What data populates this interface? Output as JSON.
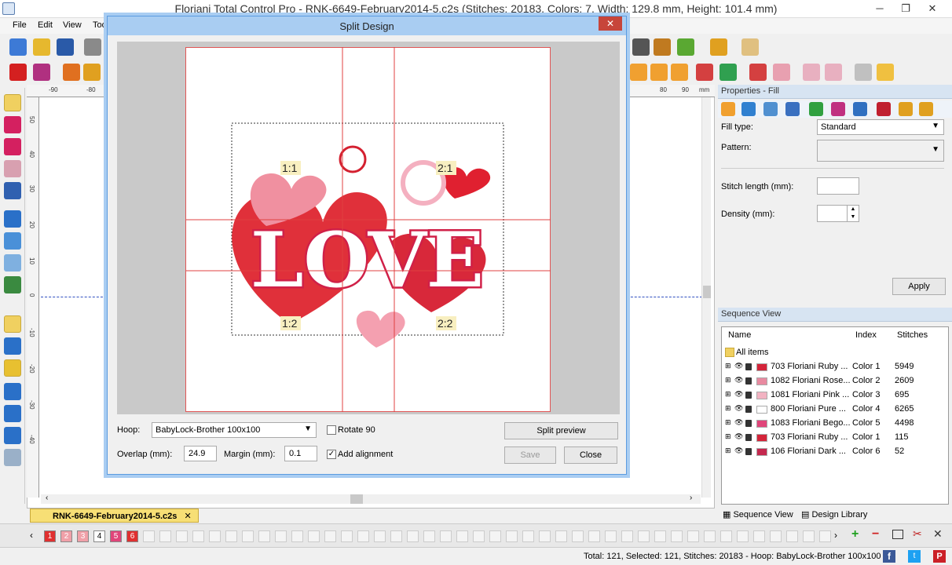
{
  "window": {
    "title": "Floriani Total Control Pro - RNK-6649-February2014-5.c2s (Stitches: 20183, Colors: 7, Width: 129.8 mm, Height: 101.4 mm)"
  },
  "menu": [
    "File",
    "Edit",
    "View",
    "Too"
  ],
  "ruler": {
    "h_labels": [
      "-90",
      "-80",
      "80",
      "90",
      "mm"
    ],
    "v_labels": [
      "50",
      "40",
      "30",
      "20",
      "10",
      "0",
      "-10",
      "-20",
      "-30",
      "-40"
    ]
  },
  "dialog": {
    "title": "Split Design",
    "close": "✕",
    "tiles": [
      "1:1",
      "2:1",
      "1:2",
      "2:2"
    ],
    "hoop_label": "Hoop:",
    "hoop_value": "BabyLock-Brother 100x100",
    "rotate_label": "Rotate 90",
    "overlap_label": "Overlap (mm):",
    "overlap_value": "24.9",
    "margin_label": "Margin (mm):",
    "margin_value": "0.1",
    "align_label": "Add alignment",
    "split_preview": "Split preview",
    "save": "Save",
    "close_btn": "Close",
    "love_text": "LOVE"
  },
  "properties": {
    "header": "Properties - Fill",
    "fill_type_label": "Fill type:",
    "fill_type_value": "Standard",
    "pattern_label": "Pattern:",
    "stitch_length_label": "Stitch length (mm):",
    "density_label": "Density (mm):",
    "apply": "Apply"
  },
  "sequence": {
    "header": "Sequence View",
    "col_name": "Name",
    "col_index": "Index",
    "col_stitches": "Stitches",
    "all_items": "All items",
    "rows": [
      {
        "name": "703 Floriani Ruby ...",
        "index": "Color 1",
        "stitches": "5949",
        "color": "#d4243a"
      },
      {
        "name": "1082 Floriani Rose...",
        "index": "Color 2",
        "stitches": "2609",
        "color": "#e88aa0"
      },
      {
        "name": "1081 Floriani Pink ...",
        "index": "Color 3",
        "stitches": "695",
        "color": "#f2b3c2"
      },
      {
        "name": "800 Floriani Pure ...",
        "index": "Color 4",
        "stitches": "6265",
        "color": "#ffffff"
      },
      {
        "name": "1083 Floriani Bego...",
        "index": "Color 5",
        "stitches": "4498",
        "color": "#e0457a"
      },
      {
        "name": "703 Floriani Ruby ...",
        "index": "Color 1",
        "stitches": "115",
        "color": "#d4243a"
      },
      {
        "name": "106 Floriani Dark ...",
        "index": "Color 6",
        "stitches": "52",
        "color": "#c4284e"
      }
    ],
    "tab_sequence": "Sequence View",
    "tab_library": "Design Library"
  },
  "doc_tab": "RNK-6649-February2014-5.c2s",
  "pages": [
    {
      "n": "1",
      "color": "#e03030"
    },
    {
      "n": "2",
      "color": "#f0a0a8"
    },
    {
      "n": "3",
      "color": "#f0a0a8"
    },
    {
      "n": "4",
      "color": "#ffffff"
    },
    {
      "n": "5",
      "color": "#e0457a"
    },
    {
      "n": "6",
      "color": "#e03030"
    }
  ],
  "status": "Total: 121, Selected: 121, Stitches: 20183 - Hoop: BabyLock-Brother 100x100"
}
